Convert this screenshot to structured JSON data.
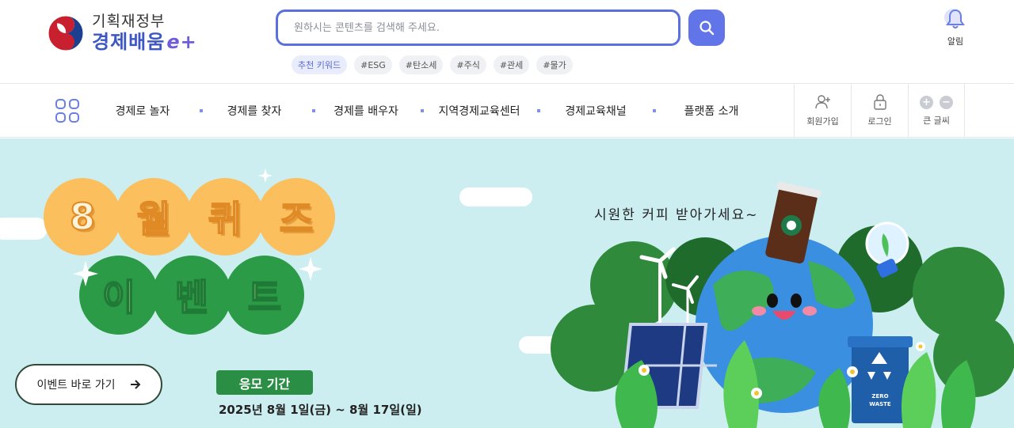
{
  "header": {
    "ministry": "기획재정부",
    "brand": "경제배움",
    "brand_suffix": "e+",
    "search": {
      "placeholder": "원하시는 콘텐츠를 검색해 주세요."
    },
    "keywords_label": "추천 키워드",
    "keywords": [
      "#ESG",
      "#탄소세",
      "#주식",
      "#관세",
      "#물가"
    ],
    "alarm_label": "알림"
  },
  "nav": {
    "items": [
      "경제로 놀자",
      "경제를 찾자",
      "경제를 배우자",
      "지역경제교육센터",
      "경제교육채널",
      "플랫폼 소개"
    ],
    "signup_label": "회원가입",
    "login_label": "로그인",
    "font_size_label": "큰 글씨"
  },
  "banner": {
    "title_line1": [
      "8",
      "월",
      "퀴",
      "즈"
    ],
    "title_line2": [
      "이",
      "벤",
      "트"
    ],
    "event_button_label": "이벤트 바로 가기",
    "apply_label": "응모 기간",
    "apply_period": "2025년 8월 1일(금) ~ 8월 17일(일)",
    "coffee_caption": "시원한 커피 받아가세요~",
    "zero_waste_text": [
      "ZERO",
      "WASTE"
    ]
  },
  "colors": {
    "accent": "#5a6fe0",
    "banner_bg": "#cdeef0",
    "title_orange": "#fbbf5e",
    "title_green": "#2c9b47"
  }
}
